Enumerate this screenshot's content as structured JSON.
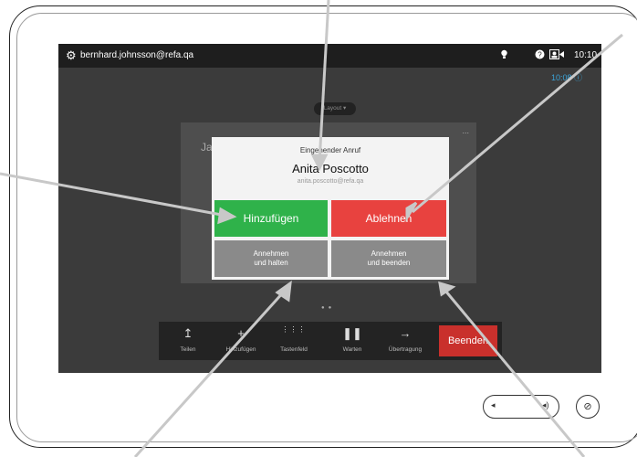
{
  "device": {
    "frame_color": "#222222"
  },
  "topbar": {
    "user": "bernhard.johnsson@refa.qa",
    "clock": "10:10",
    "icons": [
      "gear-icon",
      "lightbulb-icon",
      "help-icon",
      "camera-icon"
    ]
  },
  "screen": {
    "sub_clock": "10:08",
    "layout_button": "Layout",
    "background_caller": "Ja",
    "dots": "..."
  },
  "dialog": {
    "title": "Eingehender Anruf",
    "caller_name": "Anita Poscotto",
    "caller_email": "anita.poscotto@refa.qa",
    "add_label": "Hinzufügen",
    "decline_label": "Ablehnen",
    "hold_line1": "Annehmen",
    "hold_line2": "und halten",
    "end_line1": "Annehmen",
    "end_line2": "und beenden",
    "colors": {
      "add": "#2fb24a",
      "decline": "#e8423f",
      "secondary": "#8a8a8a"
    }
  },
  "toolbar": {
    "items": [
      {
        "label": "Teilen",
        "icon": "share-icon"
      },
      {
        "label": "Hinzufügen",
        "icon": "add-icon"
      },
      {
        "label": "Tastenfeld",
        "icon": "keypad-icon"
      },
      {
        "label": "Warten",
        "icon": "pause-icon"
      },
      {
        "label": "Übertragung",
        "icon": "transfer-icon"
      }
    ],
    "end_call": "Beenden",
    "end_color": "#c9302c"
  },
  "hardware": {
    "volume_minus": "volume-down-icon",
    "volume_plus": "volume-up-icon",
    "mute": "mute-mic-icon"
  }
}
